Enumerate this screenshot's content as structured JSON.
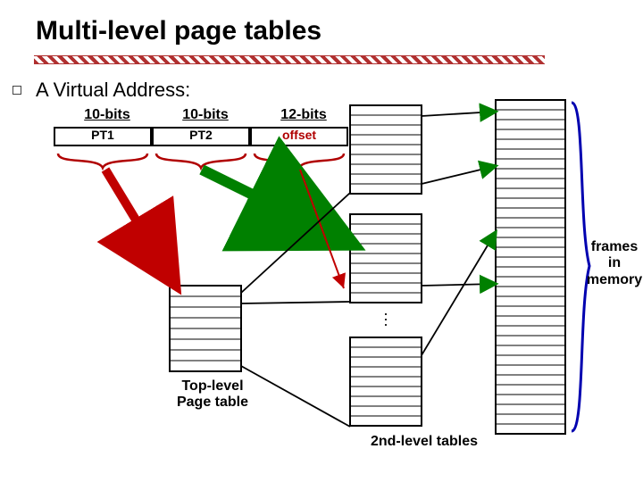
{
  "title": "Multi-level page tables",
  "subtitle": "A Virtual Address:",
  "fields": {
    "pt1": {
      "bits": "10-bits",
      "name": "PT1"
    },
    "pt2": {
      "bits": "10-bits",
      "name": "PT2"
    },
    "offset": {
      "bits": "12-bits",
      "name": "offset"
    }
  },
  "labels": {
    "top_level": "Top-level\nPage table",
    "second_level": "2nd-level tables",
    "frames": "frames\nin\nmemory"
  },
  "colors": {
    "arrow_red": "#c00000",
    "arrow_green": "#008000",
    "brace_red": "#b00000",
    "brace_blue": "#0000b0"
  },
  "tables": {
    "top_level": {
      "rows": 8
    },
    "second_a": {
      "rows": 9
    },
    "second_b": {
      "rows": 9
    },
    "second_c": {
      "rows": 9
    },
    "frames": {
      "rows": 34
    }
  }
}
